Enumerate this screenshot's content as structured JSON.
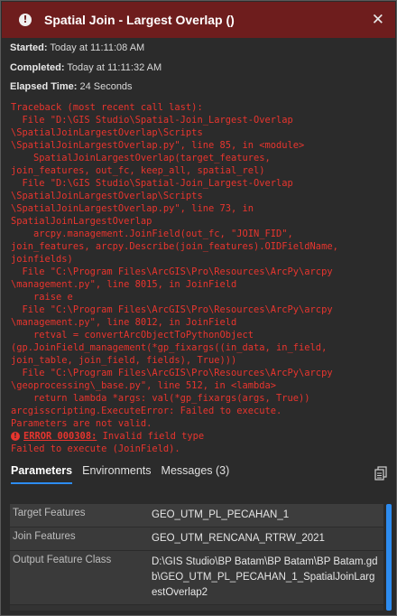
{
  "window": {
    "title": "Spatial Join - Largest Overlap ()",
    "close_glyph": "✕"
  },
  "meta": {
    "started_label": "Started:",
    "started_value": "Today at 11:11:08 AM",
    "completed_label": "Completed:",
    "completed_value": "Today at 11:11:32 AM",
    "elapsed_label": "Elapsed Time:",
    "elapsed_value": "24 Seconds"
  },
  "traceback": "Traceback (most recent call last):\n  File \"D:\\GIS Studio\\Spatial-Join_Largest-Overlap\n\\SpatialJoinLargestOverlap\\Scripts\n\\SpatialJoinLargestOverlap.py\", line 85, in <module>\n    SpatialJoinLargestOverlap(target_features,\njoin_features, out_fc, keep_all, spatial_rel)\n  File \"D:\\GIS Studio\\Spatial-Join_Largest-Overlap\n\\SpatialJoinLargestOverlap\\Scripts\n\\SpatialJoinLargestOverlap.py\", line 73, in\nSpatialJoinLargestOverlap\n    arcpy.management.JoinField(out_fc, \"JOIN_FID\",\njoin_features, arcpy.Describe(join_features).OIDFieldName,\njoinfields)\n  File \"C:\\Program Files\\ArcGIS\\Pro\\Resources\\ArcPy\\arcpy\n\\management.py\", line 8015, in JoinField\n    raise e\n  File \"C:\\Program Files\\ArcGIS\\Pro\\Resources\\ArcPy\\arcpy\n\\management.py\", line 8012, in JoinField\n    retval = convertArcObjectToPythonObject\n(gp.JoinField_management(*gp_fixargs((in_data, in_field,\njoin_table, join_field, fields), True)))\n  File \"C:\\Program Files\\ArcGIS\\Pro\\Resources\\ArcPy\\arcpy\n\\geoprocessing\\_base.py\", line 512, in <lambda>\n    return lambda *args: val(*gp_fixargs(args, True))\narcgisscripting.ExecuteError: Failed to execute.\nParameters are not valid.",
  "error": {
    "code": "ERROR 000308:",
    "message": " Invalid field type",
    "failed": "Failed to execute (JoinField)."
  },
  "tabs": [
    {
      "label": "Parameters",
      "active": true
    },
    {
      "label": "Environments",
      "active": false
    },
    {
      "label": "Messages (3)",
      "active": false
    }
  ],
  "parameters": [
    {
      "name": "Target Features",
      "value": "GEO_UTM_PL_PECAHAN_1"
    },
    {
      "name": "Join Features",
      "value": "GEO_UTM_RENCANA_RTRW_2021"
    },
    {
      "name": "Output Feature Class",
      "value": "D:\\GIS Studio\\BP Batam\\BP Batam\\BP Batam.gdb\\GEO_UTM_PL_PECAHAN_1_SpatialJoinLargestOverlap2"
    }
  ],
  "colors": {
    "titlebar": "#6e1d1d",
    "error_text": "#e8352e",
    "accent": "#2d8cf0"
  }
}
